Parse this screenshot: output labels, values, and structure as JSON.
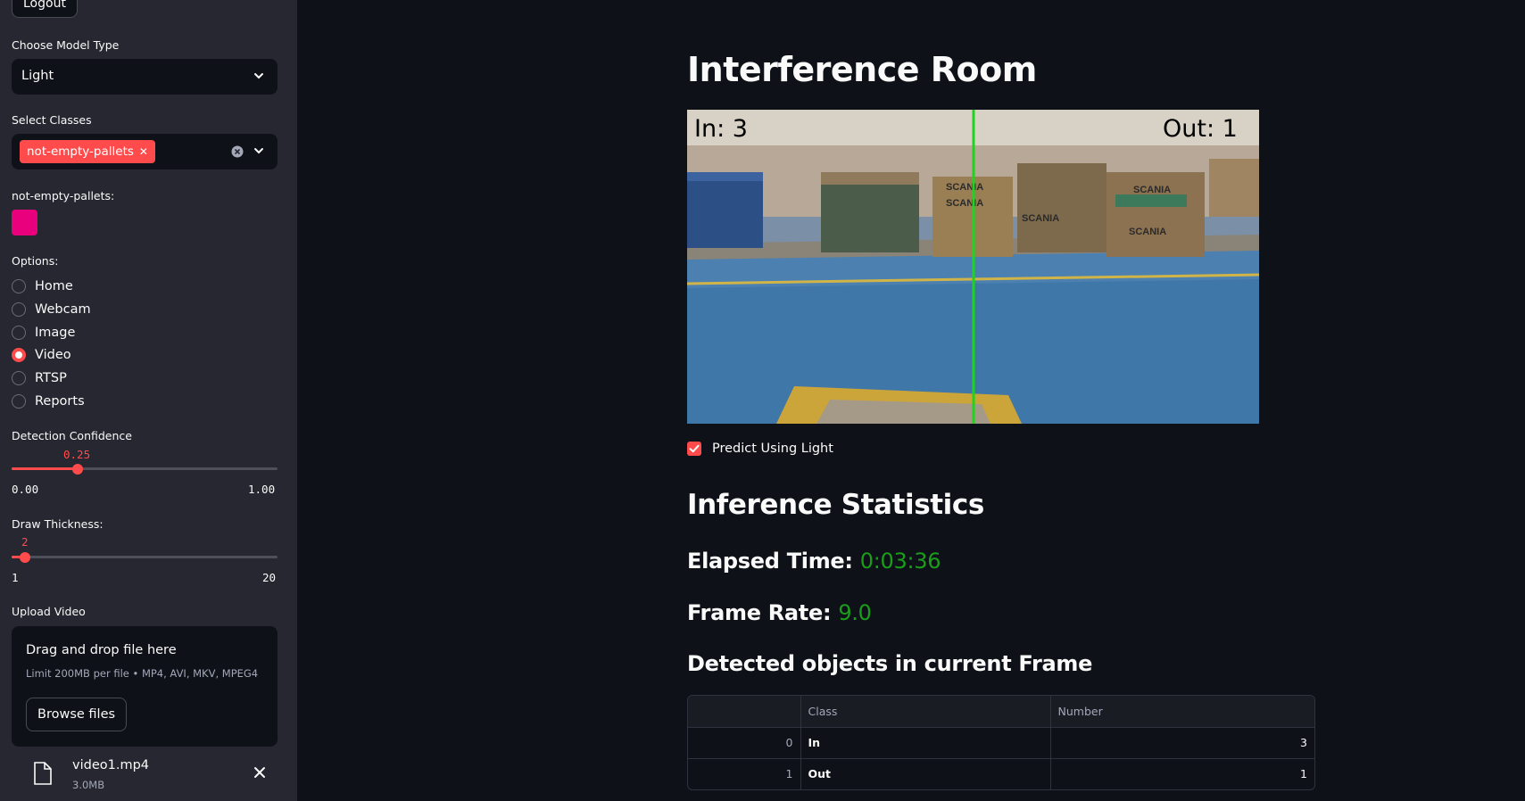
{
  "sidebar": {
    "logout_label": "Logout",
    "model_type": {
      "label": "Choose Model Type",
      "value": "Light"
    },
    "classes": {
      "label": "Select Classes",
      "selected": [
        "not-empty-pallets"
      ]
    },
    "class_color": {
      "label": "not-empty-pallets:",
      "color": "#e8007c"
    },
    "options": {
      "label": "Options:",
      "items": [
        {
          "label": "Home",
          "selected": false
        },
        {
          "label": "Webcam",
          "selected": false
        },
        {
          "label": "Image",
          "selected": false
        },
        {
          "label": "Video",
          "selected": true
        },
        {
          "label": "RTSP",
          "selected": false
        },
        {
          "label": "Reports",
          "selected": false
        }
      ]
    },
    "confidence": {
      "label": "Detection Confidence",
      "value": "0.25",
      "min": "0.00",
      "max": "1.00",
      "fraction": 0.25
    },
    "thickness": {
      "label": "Draw Thickness:",
      "value": "2",
      "min": "1",
      "max": "20",
      "fraction": 0.0526
    },
    "upload": {
      "label": "Upload Video",
      "drop_text": "Drag and drop file here",
      "limit_text": "Limit 200MB per file • MP4, AVI, MKV, MPEG4",
      "browse_label": "Browse files",
      "file_name": "video1.mp4",
      "file_size": "3.0MB"
    }
  },
  "main": {
    "title": "Interference Room",
    "frame_overlay": {
      "in_text": "In: 3",
      "out_text": "Out: 1",
      "crate_text": "SCANIA"
    },
    "predict_checkbox": {
      "label": "Predict Using Light",
      "checked": true
    },
    "stats_title": "Inference Statistics",
    "elapsed": {
      "label": "Elapsed Time:",
      "value": "0:03:36"
    },
    "frame_rate": {
      "label": "Frame Rate:",
      "value": "9.0"
    },
    "detected_title": "Detected objects in current Frame",
    "table": {
      "columns": [
        "",
        "Class",
        "Number"
      ],
      "rows": [
        {
          "index": "0",
          "class": "In",
          "number": "3"
        },
        {
          "index": "1",
          "class": "Out",
          "number": "1"
        }
      ]
    }
  },
  "colors": {
    "accent": "#ff4b4b",
    "stat_value": "#1a9e1a",
    "sidebar_bg": "#262730",
    "main_bg": "#0e1117"
  }
}
